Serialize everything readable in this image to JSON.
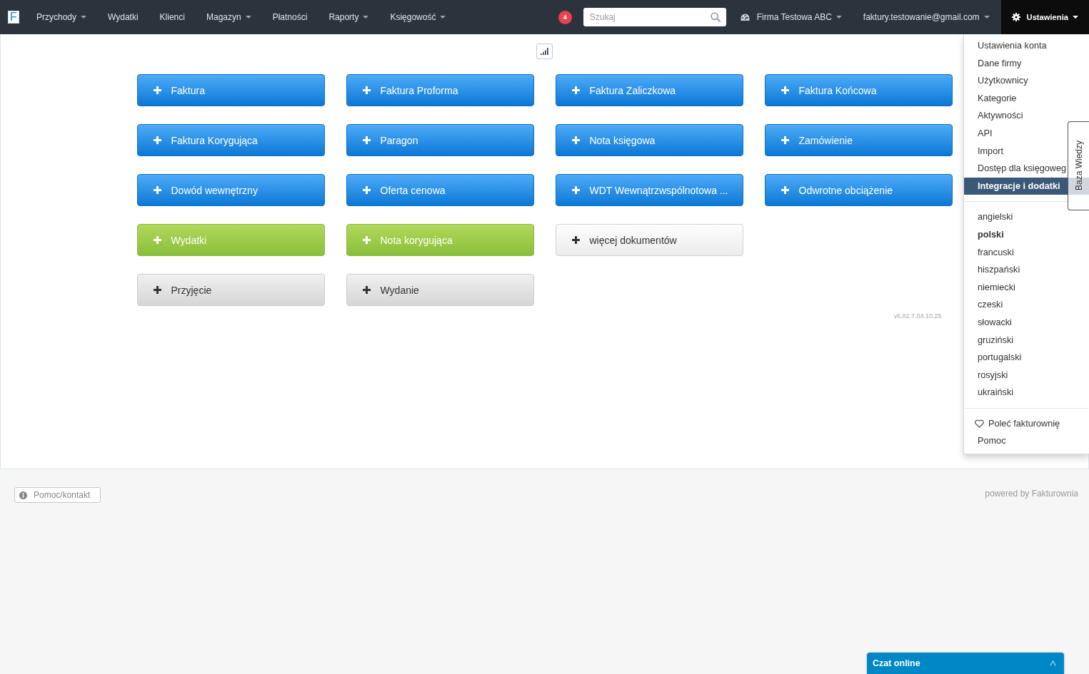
{
  "navbar": {
    "logo": "F",
    "menu": [
      {
        "label": "Przychody",
        "dropdown": true
      },
      {
        "label": "Wydatki",
        "dropdown": false
      },
      {
        "label": "Klienci",
        "dropdown": false
      },
      {
        "label": "Magazyn",
        "dropdown": true
      },
      {
        "label": "Płatności",
        "dropdown": false
      },
      {
        "label": "Raporty",
        "dropdown": true
      },
      {
        "label": "Księgowość",
        "dropdown": true
      }
    ],
    "notifications": "4",
    "search": {
      "placeholder": "Szukaj"
    },
    "company": {
      "label": "Firma Testowa ABC",
      "dropdown": true
    },
    "account": {
      "label": "faktury.testowanie@gmail.com",
      "dropdown": true
    },
    "settings": {
      "label": "Ustawienia",
      "dropdown": true,
      "open": true
    }
  },
  "settings_menu": {
    "items": [
      {
        "label": "Ustawienia konta",
        "selected": false
      },
      {
        "label": "Dane firmy",
        "selected": false
      },
      {
        "label": "Użytkownicy",
        "selected": false
      },
      {
        "label": "Kategorie",
        "selected": false
      },
      {
        "label": "Aktywności",
        "selected": false
      },
      {
        "label": "API",
        "selected": false
      },
      {
        "label": "Import",
        "selected": false
      },
      {
        "label": "Dostęp dla księgoweg",
        "selected": false
      },
      {
        "label": "Integracje i dodatki",
        "selected": true
      }
    ],
    "languages": [
      {
        "label": "angielski",
        "selected": false
      },
      {
        "label": "polski",
        "selected": true
      },
      {
        "label": "francuski",
        "selected": false
      },
      {
        "label": "hiszpański",
        "selected": false
      },
      {
        "label": "niemiecki",
        "selected": false
      },
      {
        "label": "czeski",
        "selected": false
      },
      {
        "label": "słowacki",
        "selected": false
      },
      {
        "label": "gruziński",
        "selected": false
      },
      {
        "label": "portugalski",
        "selected": false
      },
      {
        "label": "rosyjski",
        "selected": false
      },
      {
        "label": "ukraiński",
        "selected": false
      }
    ],
    "links": [
      {
        "label": "Poleć fakturownię",
        "kind": "recommend"
      },
      {
        "label": "Pomoc",
        "kind": "plain"
      }
    ]
  },
  "knowledge_tab": {
    "label": "Baza Wiedzy"
  },
  "document_rows": [
    [
      {
        "label": "Faktura",
        "kind": "primary"
      },
      {
        "label": "Faktura Proforma",
        "kind": "primary"
      },
      {
        "label": "Faktura Zaliczkowa",
        "kind": "primary"
      },
      {
        "label": "Faktura Końcowa",
        "kind": "primary"
      }
    ],
    [
      {
        "label": "Faktura Korygująca",
        "kind": "primary"
      },
      {
        "label": "Paragon",
        "kind": "primary"
      },
      {
        "label": "Nota księgowa",
        "kind": "primary"
      },
      {
        "label": "Zamówienie",
        "kind": "primary"
      }
    ],
    [
      {
        "label": "Dowód wewnętrzny",
        "kind": "primary"
      },
      {
        "label": "Oferta cenowa",
        "kind": "primary"
      },
      {
        "label": "WDT Wewnątrzwspólnotowa ...",
        "kind": "primary"
      },
      {
        "label": "Odwrotne obciążenie",
        "kind": "primary"
      }
    ],
    [
      {
        "label": "Wydatki",
        "kind": "success"
      },
      {
        "label": "Nota korygująca",
        "kind": "success"
      },
      {
        "label": "więcej dokumentów",
        "kind": "light"
      }
    ],
    [
      {
        "label": "Przyjęcie",
        "kind": "default"
      },
      {
        "label": "Wydanie",
        "kind": "default"
      }
    ]
  ],
  "version": "v6.82.7.04.10.25",
  "footer": {
    "help_button": "Pomoc/kontakt",
    "powered_by": "powered by Fakturownia"
  },
  "chat": {
    "label": "Czat online"
  }
}
